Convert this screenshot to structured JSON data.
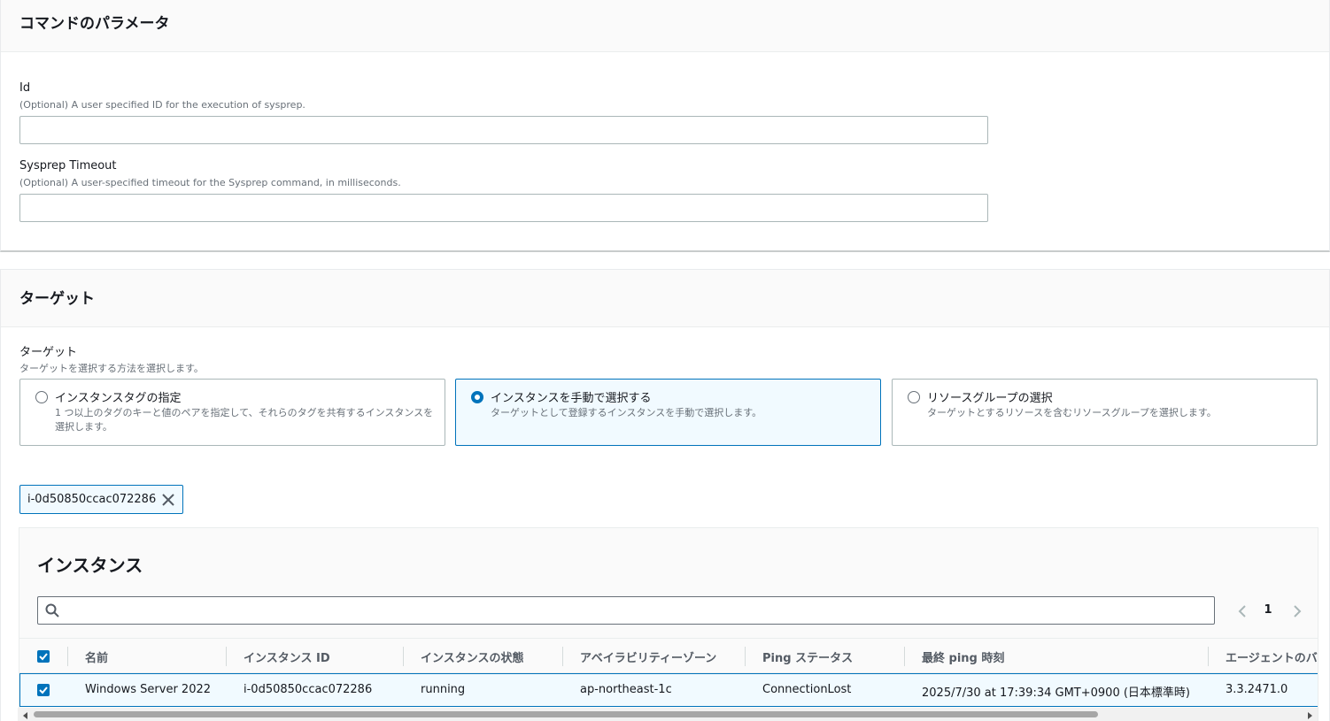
{
  "params": {
    "title": "コマンドのパラメータ",
    "id_field": {
      "label": "Id",
      "description": "(Optional) A user specified ID for the execution of sysprep.",
      "value": ""
    },
    "timeout_field": {
      "label": "Sysprep Timeout",
      "description": "(Optional) A user-specified timeout for the Sysprep command, in milliseconds.",
      "value": ""
    }
  },
  "targets": {
    "title": "ターゲット",
    "label": "ターゲット",
    "description": "ターゲットを選択する方法を選択します。",
    "options": [
      {
        "title": "インスタンスタグの指定",
        "description": "1 つ以上のタグのキーと値のペアを指定して、それらのタグを共有するインスタンスを選択します。",
        "selected": false
      },
      {
        "title": "インスタンスを手動で選択する",
        "description": "ターゲットとして登録するインスタンスを手動で選択します。",
        "selected": true
      },
      {
        "title": "リソースグループの選択",
        "description": "ターゲットとするリソースを含むリソースグループを選択します。",
        "selected": false
      }
    ],
    "selected_token": "i-0d50850ccac072286"
  },
  "instances": {
    "title": "インスタンス",
    "search_value": "",
    "pagination": {
      "current_page": "1"
    },
    "columns": [
      "名前",
      "インスタンス ID",
      "インスタンスの状態",
      "アベイラビリティーゾーン",
      "Ping ステータス",
      "最終 ping 時刻",
      "エージェントのバ"
    ],
    "rows": [
      {
        "checked": true,
        "cells": [
          "Windows Server 2022",
          "i-0d50850ccac072286",
          "running",
          "ap-northeast-1c",
          "ConnectionLost",
          "2025/7/30 at 17:39:34 GMT+0900 (日本標準時)",
          "3.3.2471.0"
        ]
      }
    ],
    "header_checked": true
  },
  "colors": {
    "accent": "#0073bb",
    "selected_bg": "#f1faff",
    "text": "#16191f",
    "muted": "#687078"
  }
}
